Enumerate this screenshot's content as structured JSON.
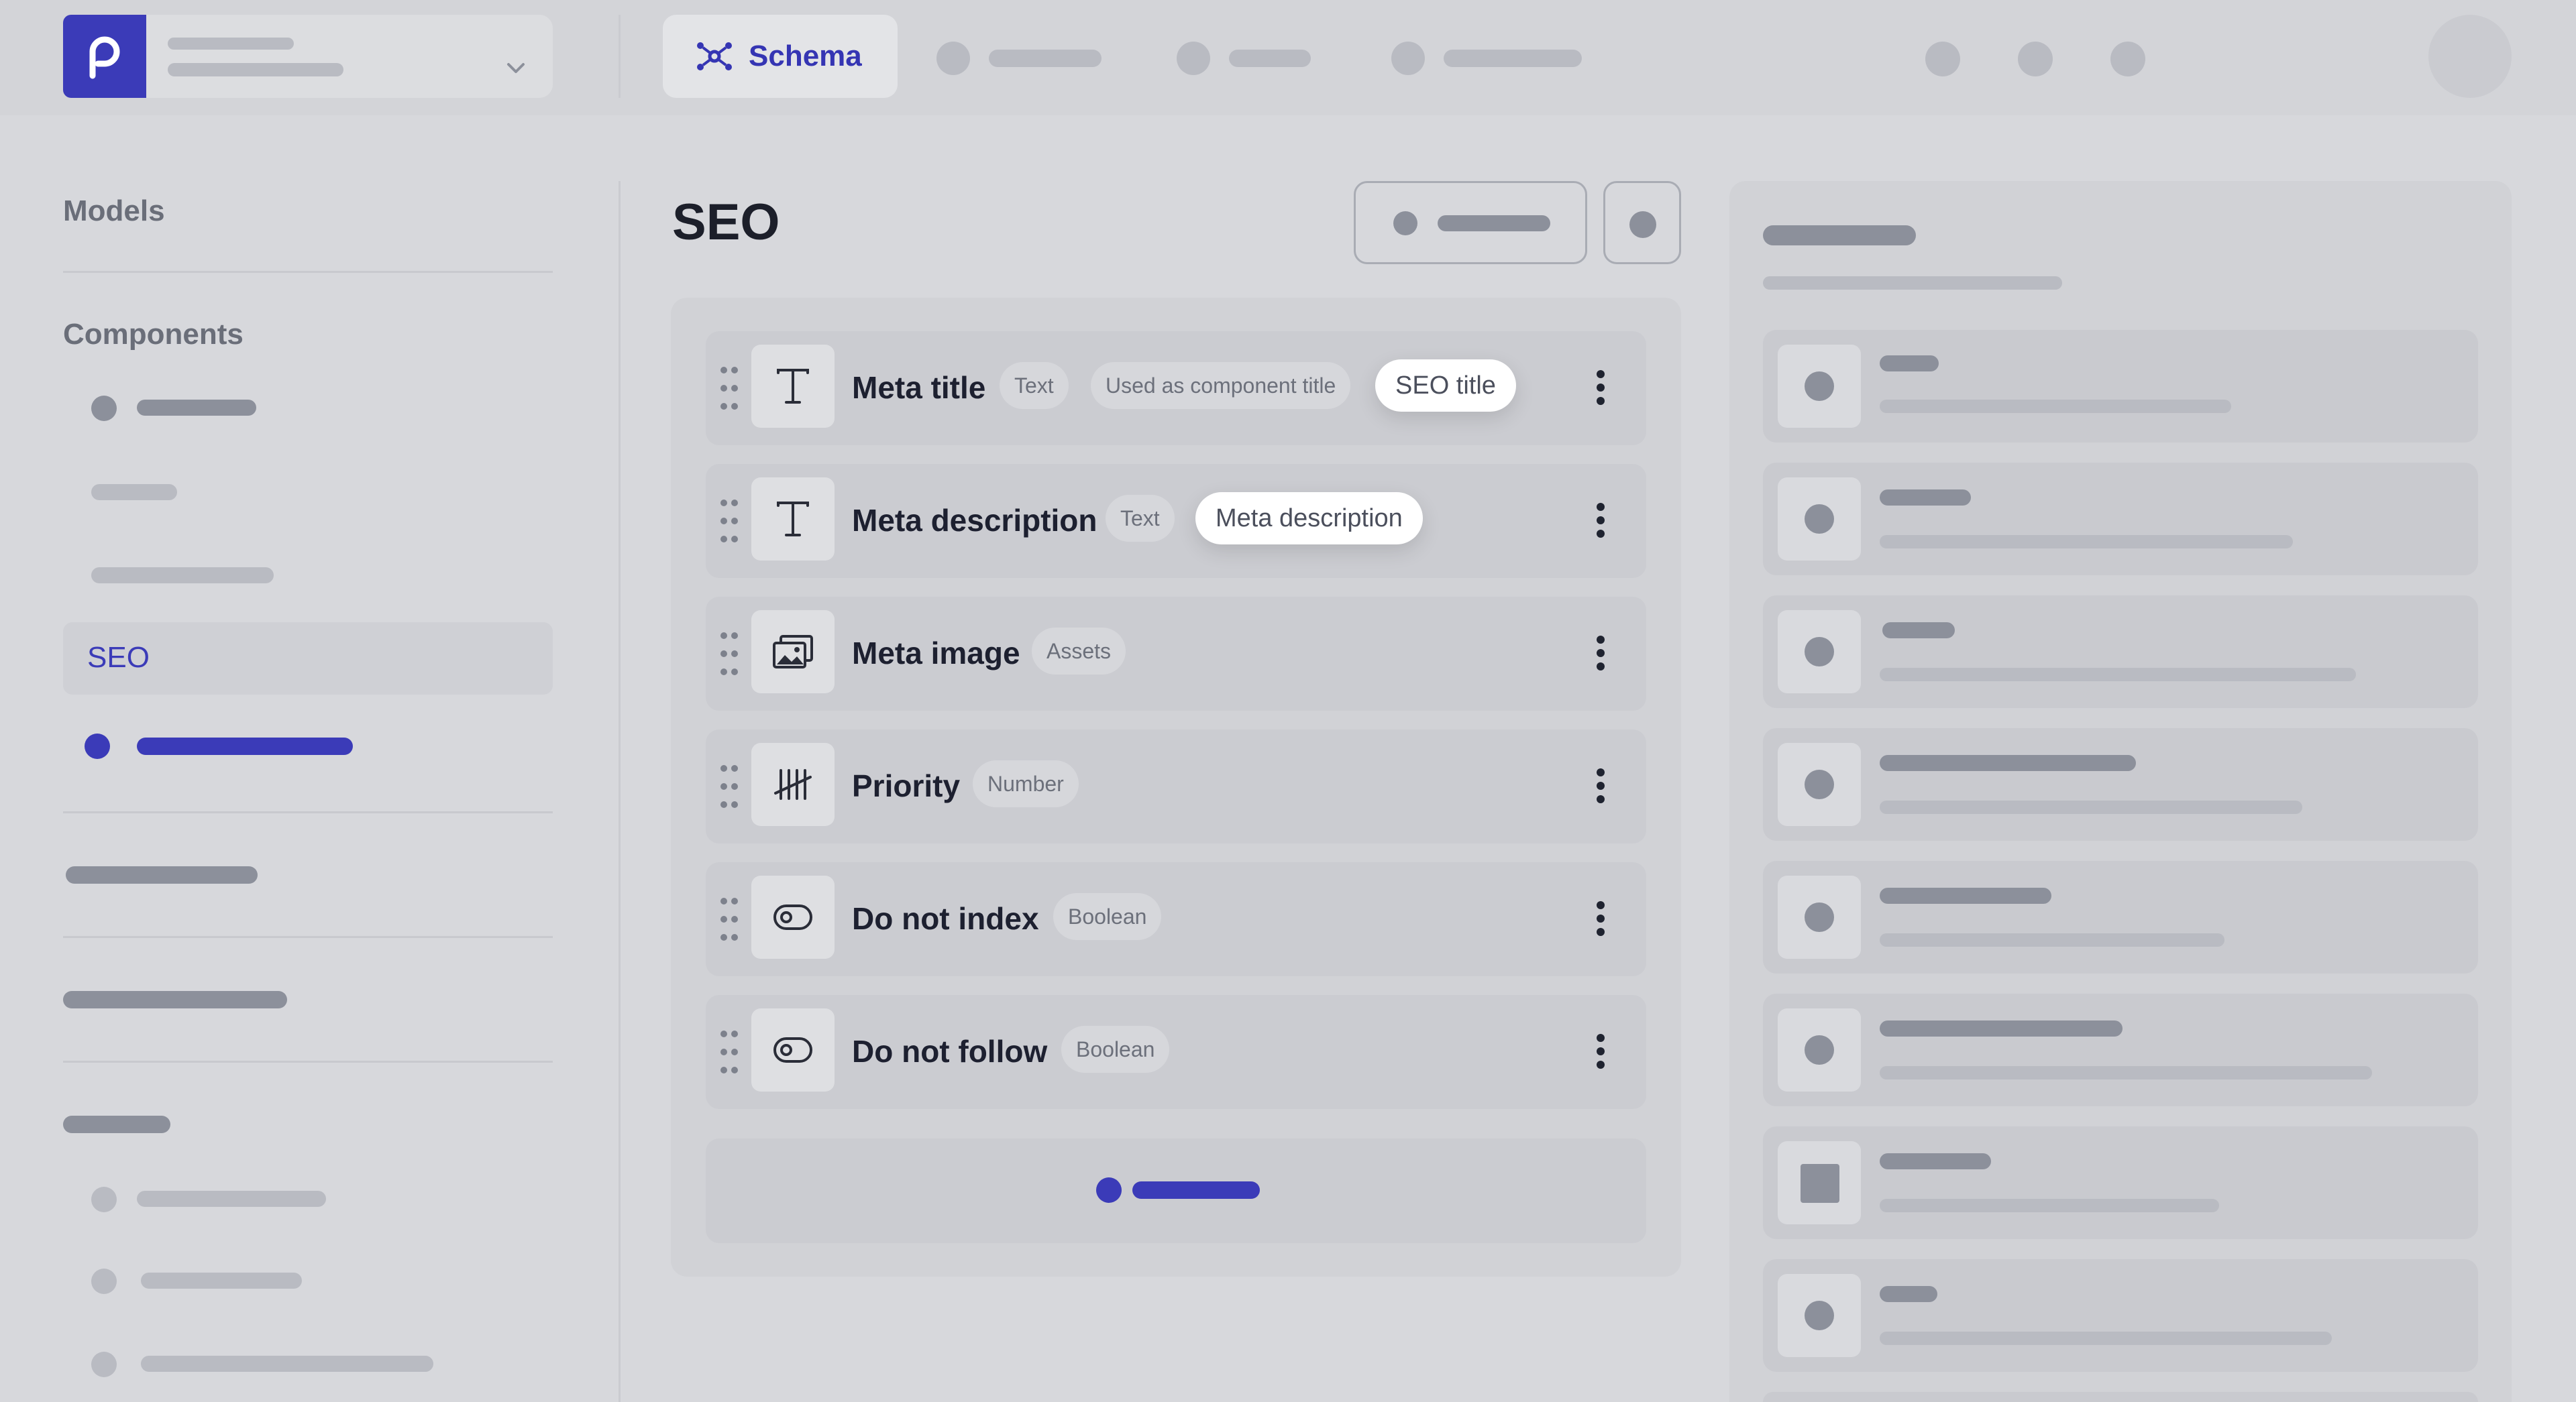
{
  "header": {
    "active_tab": "Schema"
  },
  "sidebar": {
    "models_heading": "Models",
    "components_heading": "Components",
    "active_item": "SEO"
  },
  "main": {
    "title": "SEO",
    "fields": [
      {
        "name": "Meta title",
        "type": "Text",
        "note": "Used as component title",
        "pill": "SEO title",
        "icon": "text-icon"
      },
      {
        "name": "Meta description",
        "type": "Text",
        "pill": "Meta description",
        "icon": "text-icon"
      },
      {
        "name": "Meta image",
        "type": "Assets",
        "icon": "image-icon"
      },
      {
        "name": "Priority",
        "type": "Number",
        "icon": "number-tally-icon"
      },
      {
        "name": "Do not index",
        "type": "Boolean",
        "icon": "toggle-icon"
      },
      {
        "name": "Do not follow",
        "type": "Boolean",
        "icon": "toggle-icon"
      }
    ]
  },
  "colors": {
    "accent": "#3b3bb8",
    "background": "#d7d8dc"
  }
}
